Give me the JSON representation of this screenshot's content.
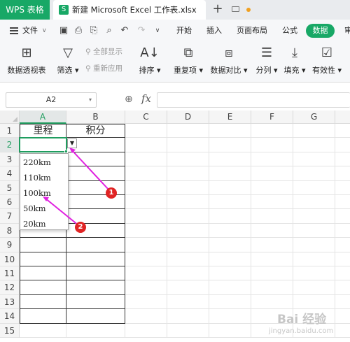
{
  "tabs": {
    "app": "WPS 表格",
    "doc_icon": "S",
    "document": "新建 Microsoft Excel 工作表.xlsx",
    "new_tab": "+"
  },
  "menu": {
    "file": "文件",
    "items": [
      "开始",
      "插入",
      "页面布局",
      "公式",
      "数据",
      "审"
    ],
    "active": "数据"
  },
  "ribbon": {
    "pivot": "数据透视表",
    "filter": "筛选",
    "show_all": "全部显示",
    "reapply": "重新应用",
    "sort": "排序",
    "duplicates": "重复项",
    "compare": "数据对比",
    "split": "分列",
    "fill": "填充",
    "validity": "有效性"
  },
  "formula_bar": {
    "name_box": "A2",
    "fx": "fx",
    "value": ""
  },
  "columns": [
    "A",
    "B",
    "C",
    "D",
    "E",
    "F",
    "G"
  ],
  "rows": [
    "1",
    "2",
    "3",
    "4",
    "5",
    "6",
    "7",
    "8",
    "9",
    "10",
    "11",
    "12",
    "13",
    "14",
    "15"
  ],
  "cells": {
    "A1": "里程",
    "B1": "积分"
  },
  "dropdown": {
    "options": [
      "220km",
      "110km",
      "100km",
      "50km",
      "20km"
    ]
  },
  "annotations": {
    "badge1": "1",
    "badge2": "2"
  },
  "watermark": {
    "line1": "Bai 经验",
    "line2": "jingyan.baidu.com"
  },
  "colors": {
    "brand": "#18a866",
    "selection": "#1f9d5f",
    "annotation_arrow": "#e020e0",
    "badge": "#e02424"
  }
}
